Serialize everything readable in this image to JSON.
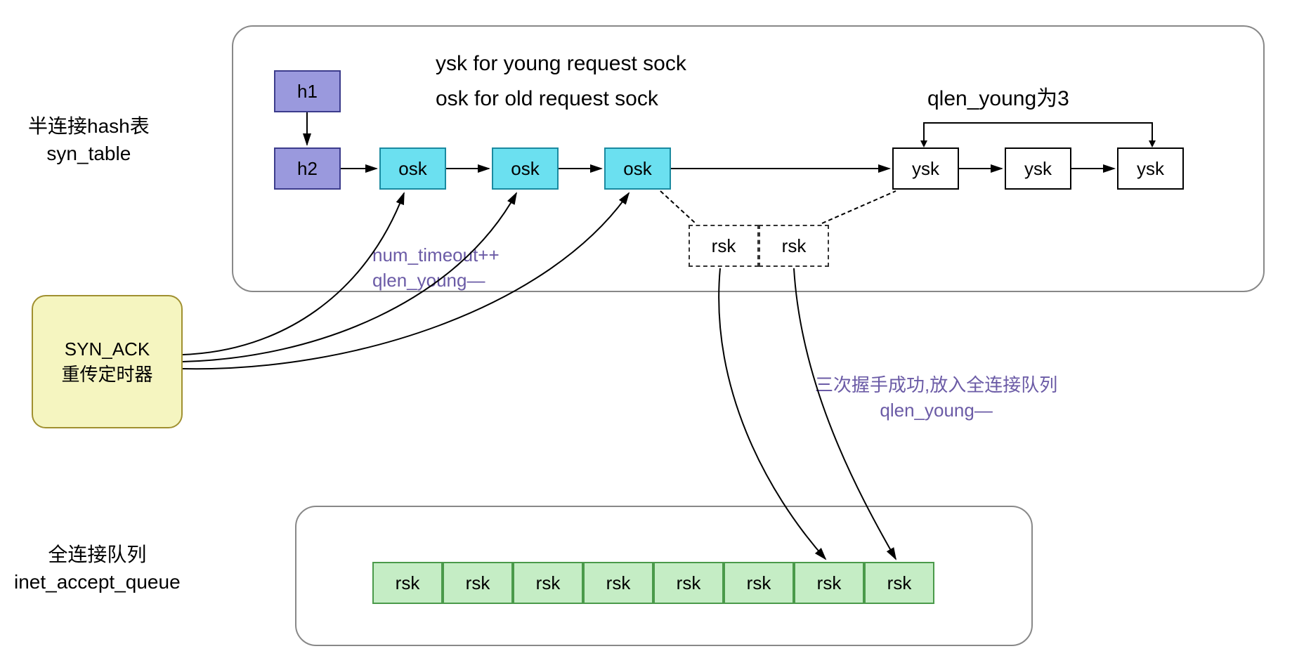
{
  "labels": {
    "syn_table_title_1": "半连接hash表",
    "syn_table_title_2": "syn_table",
    "accept_queue_title_1": "全连接队列",
    "accept_queue_title_2": "inet_accept_queue",
    "ysk_desc": "ysk for young request sock",
    "osk_desc": "osk for old request sock",
    "qlen_young_label": "qlen_young为3",
    "timeout_note_1": "num_timeout++",
    "timeout_note_2": "qlen_young—",
    "handshake_note_1": "三次握手成功,放入全连接队列",
    "handshake_note_2": "qlen_young—",
    "timer_1": "SYN_ACK",
    "timer_2": "重传定时器"
  },
  "nodes": {
    "h1": "h1",
    "h2": "h2",
    "osk": "osk",
    "ysk": "ysk",
    "rsk": "rsk"
  }
}
